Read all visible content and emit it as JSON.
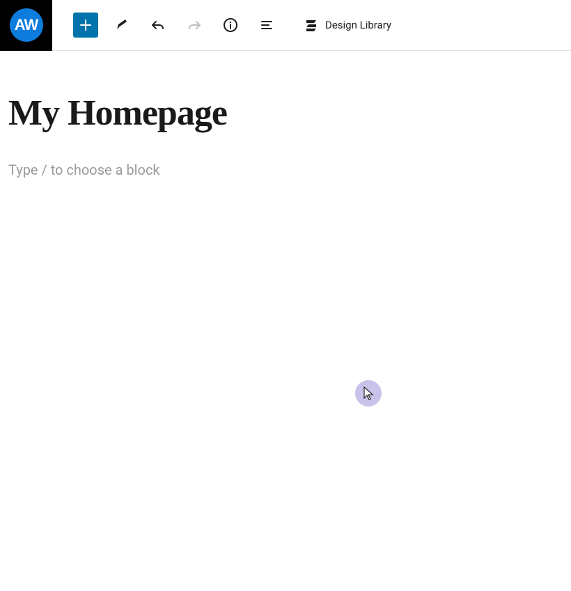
{
  "logo": {
    "text": "AW"
  },
  "toolbar": {
    "design_library_label": "Design Library"
  },
  "content": {
    "title": "My Homepage",
    "placeholder": "Type / to choose a block"
  }
}
